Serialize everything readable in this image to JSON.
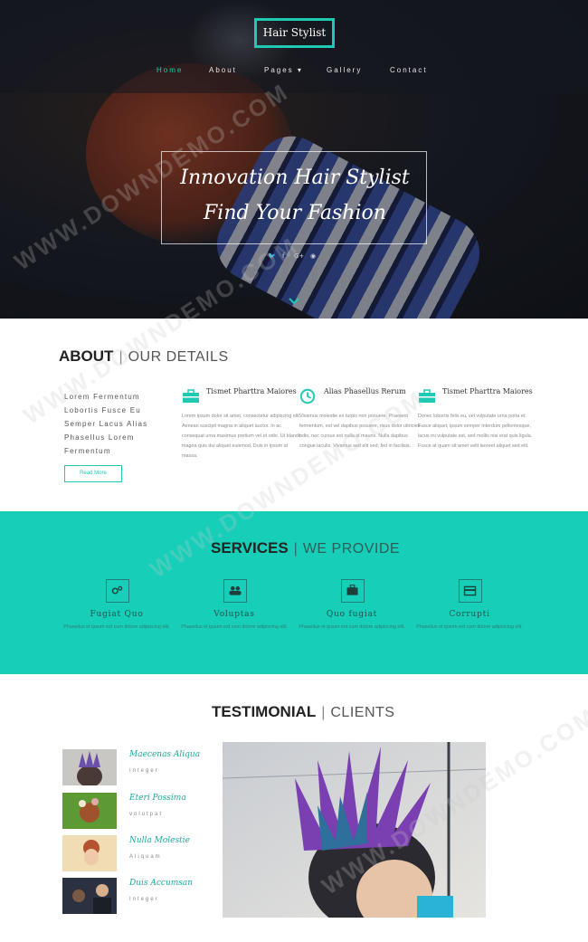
{
  "brand": {
    "logo": "Hair Stylist",
    "accent": "#20c9b3"
  },
  "nav": {
    "items": [
      {
        "label": "Home",
        "active": true
      },
      {
        "label": "About"
      },
      {
        "label": "Pages ▾"
      },
      {
        "label": "Gallery"
      },
      {
        "label": "Contact"
      }
    ]
  },
  "hero": {
    "line1": "Innovation Hair Stylist",
    "line2": "Find Your Fashion",
    "social": [
      "twitter-icon",
      "facebook-icon",
      "google-plus-icon",
      "dribbble-icon"
    ]
  },
  "about": {
    "title": "ABOUT",
    "subtitle": "OUR DETAILS",
    "list": [
      "Lorem Fermentum",
      "Lobortis Fusce Eu",
      "Semper Lacus Alias",
      "Phasellus Lorem",
      "Fermentum"
    ],
    "button": "Read More",
    "columns": [
      {
        "icon": "briefcase-icon",
        "heading": "Tismet Pharttra Maiores",
        "body": "Lorem ipsum dolor sit amet, consectetur adipiscing elit. Aenean suscipit magna in aliquet auctor. In ac consequat urna maximus pretium vel et odio. Ut blandit magna quis dui aliquet euismod. Duis in ipsum id massa."
      },
      {
        "icon": "clock-icon",
        "heading": "Alias Phasellus Rerum",
        "body": "Vivamus molestie ex turpis non posuere. Praesent fermentum, est vel dapibus posuere, risus dolor ultricies odio, nec cursus est nulla id mauris. Nulla dapibus congue iaculis. Vivamus sed elit sed, fed in facilisis."
      },
      {
        "icon": "briefcase-icon",
        "heading": "Tismet Pharttra Maiores",
        "body": "Donec lobortis felis eu, vel vulputate urna porta et. Fusce aliquet, ipsum semper interdum pellentesque, lacus mi vulputate est, sed mollis nisi erat quis ligula. Fusce at quam sit amet velit laoreet aliquet sed elit."
      }
    ]
  },
  "services": {
    "title": "SERVICES",
    "subtitle": "WE PROVIDE",
    "items": [
      {
        "icon": "gears-icon",
        "name": "Fugiat Quo",
        "desc": "Phasellus et ipsum est cum dolore adipiscing elit."
      },
      {
        "icon": "users-icon",
        "name": "Voluptas",
        "desc": "Phasellus et ipsum est cum dolore adipiscing elit."
      },
      {
        "icon": "briefcase-icon",
        "name": "Quo fugiat",
        "desc": "Phasellus et ipsum est cum dolore adipiscing elit."
      },
      {
        "icon": "credit-card-icon",
        "name": "Corrupti",
        "desc": "Phasellus et ipsum est cum dolore adipiscing elit."
      }
    ]
  },
  "testimonial": {
    "title": "TESTIMONIAL",
    "subtitle": "CLIENTS",
    "items": [
      {
        "name": "Maecenas Aliqua",
        "sub": "Integer"
      },
      {
        "name": "Eteri Possima",
        "sub": "volutpat"
      },
      {
        "name": "Nulla Molestie",
        "sub": "Aliquam"
      },
      {
        "name": "Duis Accumsan",
        "sub": "Integer"
      }
    ]
  },
  "watermark": "WWW.DOWNDEMO.COM"
}
